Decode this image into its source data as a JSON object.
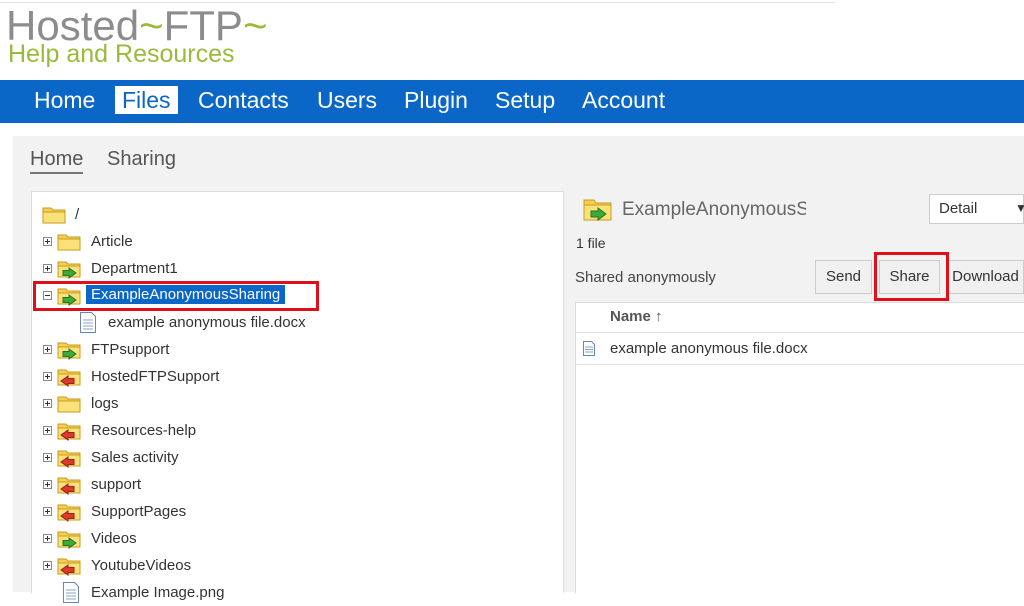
{
  "logo": {
    "line1_a": "Hosted",
    "line1_tilde1": "~",
    "line1_b": "FTP",
    "line1_tilde2": "~",
    "line2": "Help and Resources"
  },
  "nav": {
    "items": [
      "Home",
      "Files",
      "Contacts",
      "Users",
      "Plugin",
      "Setup",
      "Account"
    ],
    "active": "Files"
  },
  "breadcrumb": {
    "home": "Home",
    "sharing": "Sharing"
  },
  "tree": {
    "root": "/",
    "items": [
      {
        "label": "Article",
        "icon": "folder-icon"
      },
      {
        "label": "Department1",
        "icon": "folder-shared-green-icon"
      },
      {
        "label": "ExampleAnonymousSharing",
        "icon": "folder-shared-green-icon",
        "selected": true,
        "expanded": true
      },
      {
        "label": "example anonymous file.docx",
        "icon": "document-icon",
        "child": true
      },
      {
        "label": "FTPsupport",
        "icon": "folder-shared-green-icon"
      },
      {
        "label": "HostedFTPSupport",
        "icon": "folder-shared-red-icon"
      },
      {
        "label": "logs",
        "icon": "folder-icon"
      },
      {
        "label": "Resources-help",
        "icon": "folder-shared-red-icon"
      },
      {
        "label": "Sales activity",
        "icon": "folder-shared-red-icon"
      },
      {
        "label": "support",
        "icon": "folder-shared-red-icon"
      },
      {
        "label": "SupportPages",
        "icon": "folder-shared-red-icon"
      },
      {
        "label": "Videos",
        "icon": "folder-shared-green-icon"
      },
      {
        "label": "YoutubeVideos",
        "icon": "folder-shared-red-icon"
      },
      {
        "label": "Example Image.png",
        "icon": "document-icon"
      }
    ]
  },
  "detail": {
    "title": "ExampleAnonymousS",
    "view": "Detail",
    "count": "1 file",
    "shared_status": "Shared anonymously",
    "buttons": {
      "send": "Send",
      "share": "Share",
      "download": "Download"
    },
    "columns": {
      "name": "Name ↑"
    },
    "files": [
      "example anonymous file.docx"
    ]
  },
  "colors": {
    "nav": "#0a67c8",
    "highlight": "#e0101a",
    "logo_green": "#9aba3c",
    "logo_gray": "#8c8c8c"
  }
}
